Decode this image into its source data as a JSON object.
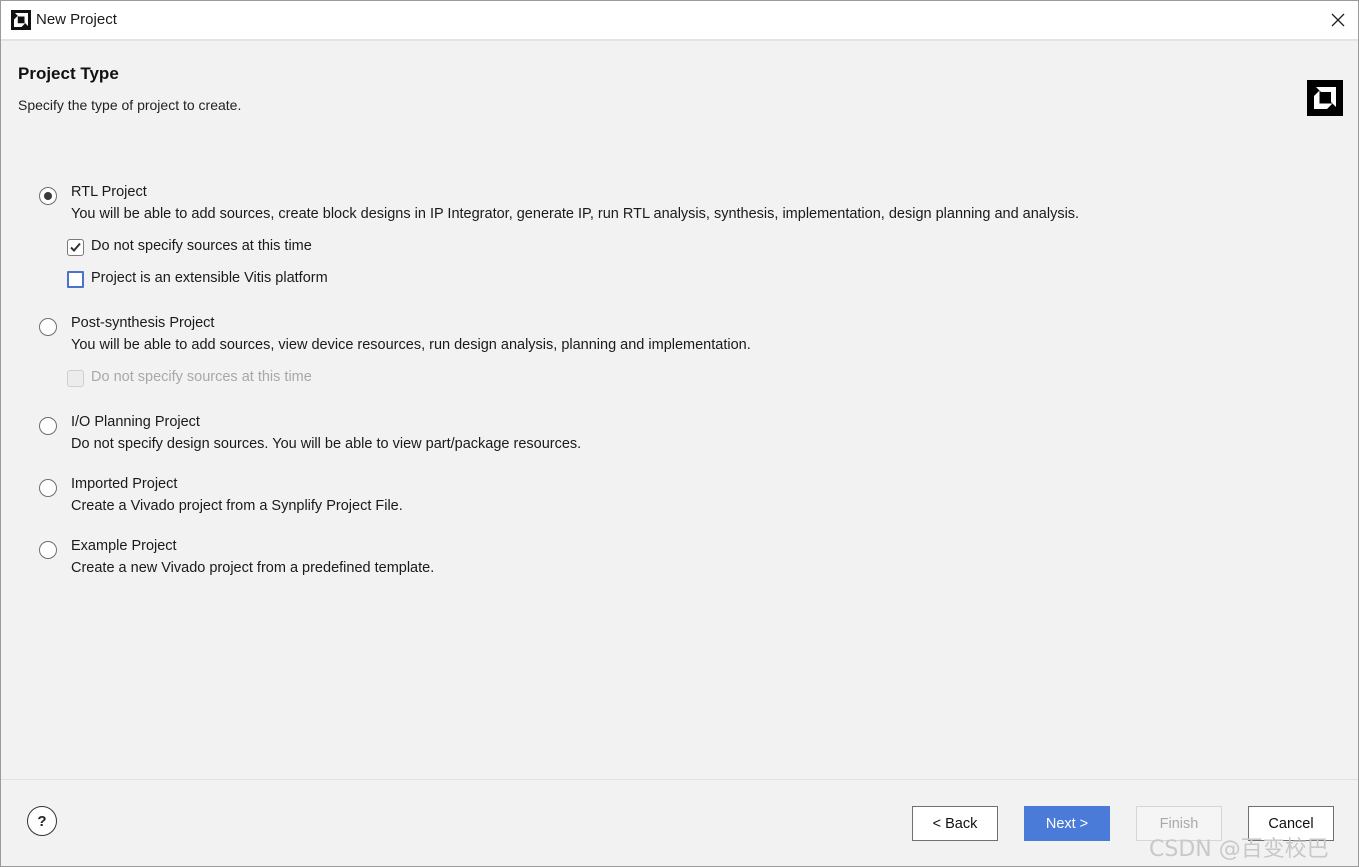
{
  "window": {
    "title": "New Project",
    "app_icon": "amd-logo-icon",
    "close_icon": "close-icon"
  },
  "header": {
    "title": "Project Type",
    "subtitle": "Specify the type of project to create.",
    "logo": "amd-logo-icon"
  },
  "options": [
    {
      "label": "RTL Project",
      "description": "You will be able to add sources, create block designs in IP Integrator, generate IP, run RTL analysis, synthesis, implementation, design planning and analysis.",
      "selected": true,
      "checkboxes": [
        {
          "label": "Do not specify sources at this time",
          "checked": true,
          "enabled": true
        },
        {
          "label": "Project is an extensible Vitis platform",
          "checked": false,
          "enabled": true
        }
      ]
    },
    {
      "label": "Post-synthesis Project",
      "description": "You will be able to add sources, view device resources, run design analysis, planning and implementation.",
      "selected": false,
      "checkboxes": [
        {
          "label": "Do not specify sources at this time",
          "checked": false,
          "enabled": false
        }
      ]
    },
    {
      "label": "I/O Planning Project",
      "description": "Do not specify design sources. You will be able to view part/package resources.",
      "selected": false
    },
    {
      "label": "Imported Project",
      "description": "Create a Vivado project from a Synplify Project File.",
      "selected": false
    },
    {
      "label": "Example Project",
      "description": "Create a new Vivado project from a predefined template.",
      "selected": false
    }
  ],
  "footer": {
    "help_label": "?",
    "back_label": "< Back",
    "next_label": "Next >",
    "finish_label": "Finish",
    "cancel_label": "Cancel"
  },
  "watermark": "CSDN @百变校巴",
  "colors": {
    "accent": "#4b7bd8",
    "background": "#f2f2f2",
    "disabled_text": "#a8a8a8"
  }
}
